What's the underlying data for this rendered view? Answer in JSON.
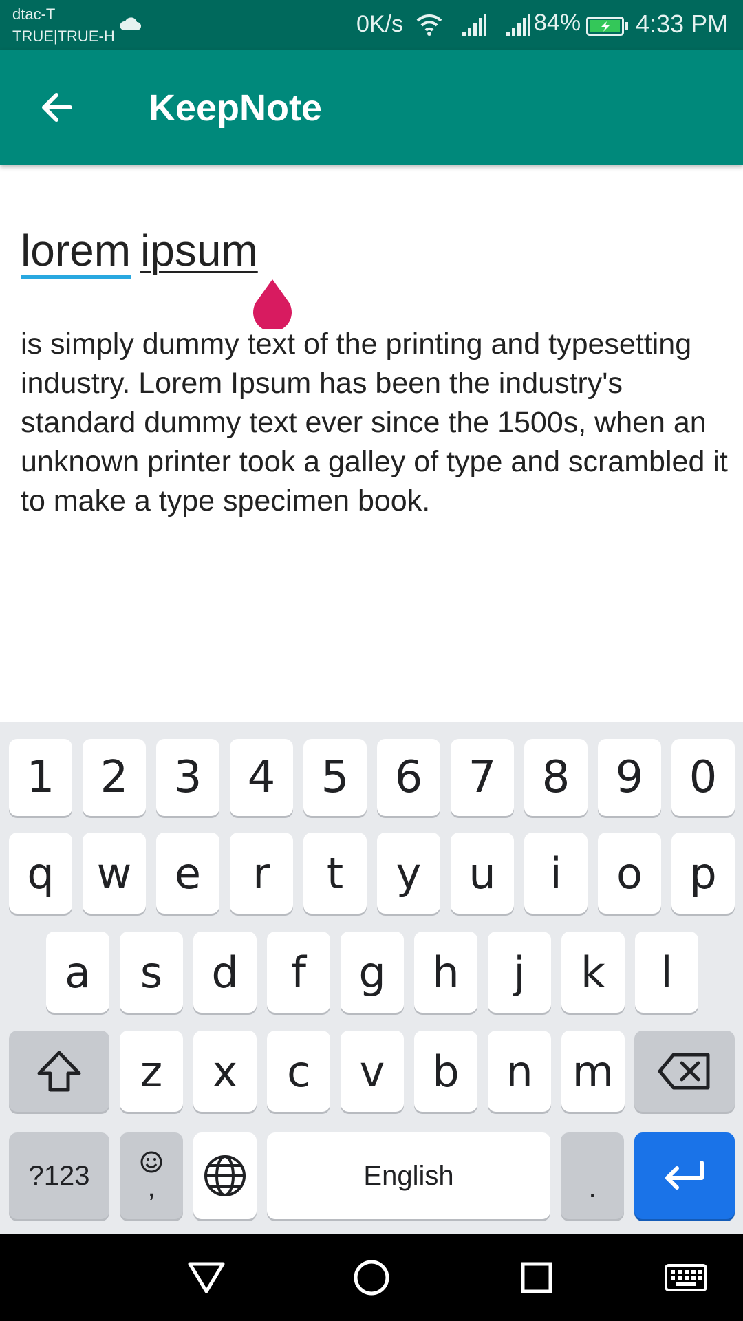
{
  "status_bar": {
    "carrier_1": "dtac-T",
    "carrier_2": "TRUE|TRUE-H",
    "net_speed": "0K/s",
    "battery": "84%",
    "time": "4:33 PM",
    "icons": [
      "cloud-icon",
      "wifi-icon",
      "signal-icon",
      "signal-icon",
      "battery-charging-icon"
    ]
  },
  "app_bar": {
    "title": "KeepNote",
    "back_icon": "arrow-back-icon",
    "color": "#00897b"
  },
  "note": {
    "title_word_1": "lorem",
    "title_word_2": "ipsum",
    "body": "is simply dummy text of the printing and typesetting industry. Lorem Ipsum has been the industry's standard dummy text ever since the 1500s, when an unknown printer took a galley of type and scrambled it to make a type specimen book.",
    "cursor_handle_color": "#d81b60"
  },
  "keyboard": {
    "digits": [
      "1",
      "2",
      "3",
      "4",
      "5",
      "6",
      "7",
      "8",
      "9",
      "0"
    ],
    "row1": [
      "q",
      "w",
      "e",
      "r",
      "t",
      "y",
      "u",
      "i",
      "o",
      "p"
    ],
    "row2": [
      "a",
      "s",
      "d",
      "f",
      "g",
      "h",
      "j",
      "k",
      "l"
    ],
    "row3": [
      "z",
      "x",
      "c",
      "v",
      "b",
      "n",
      "m"
    ],
    "symbols_label": "?123",
    "comma_label": ",",
    "space_label": "English",
    "period_label": ".",
    "enter_color": "#1a73e8",
    "icons": [
      "shift-icon",
      "backspace-icon",
      "emoji-icon",
      "globe-icon",
      "enter-icon"
    ]
  },
  "nav_bar": {
    "icons": [
      "back-triangle-icon",
      "home-circle-icon",
      "recents-square-icon",
      "keyboard-icon"
    ]
  }
}
